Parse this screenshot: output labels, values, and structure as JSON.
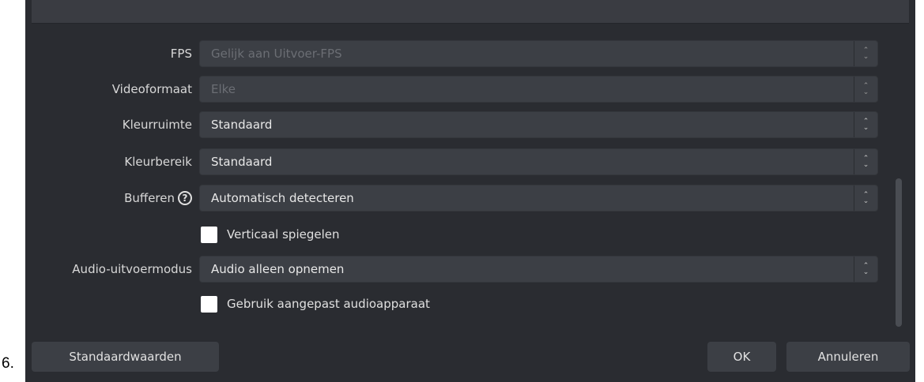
{
  "step_number": "6.",
  "form": {
    "fields": [
      {
        "label": "FPS",
        "value": "Gelijk aan Uitvoer-FPS",
        "disabled": true
      },
      {
        "label": "Videoformaat",
        "value": "Elke",
        "disabled": true
      },
      {
        "label": "Kleurruimte",
        "value": "Standaard",
        "disabled": false
      },
      {
        "label": "Kleurbereik",
        "value": "Standaard",
        "disabled": false
      },
      {
        "label": "Bufferen",
        "value": "Automatisch detecteren",
        "disabled": false,
        "has_help_icon": true
      },
      {
        "label": "Audio-uitvoermodus",
        "value": "Audio alleen opnemen",
        "disabled": false
      }
    ],
    "checkboxes": [
      {
        "label": "Verticaal spiegelen",
        "checked": false
      },
      {
        "label": "Gebruik aangepast audioapparaat",
        "checked": false
      }
    ]
  },
  "footer": {
    "defaults_label": "Standaardwaarden",
    "ok_label": "OK",
    "cancel_label": "Annuleren"
  },
  "colors": {
    "dialog_background": "#2a2c31",
    "control_background": "#3c3f45",
    "disabled_text": "#6b6e74"
  }
}
